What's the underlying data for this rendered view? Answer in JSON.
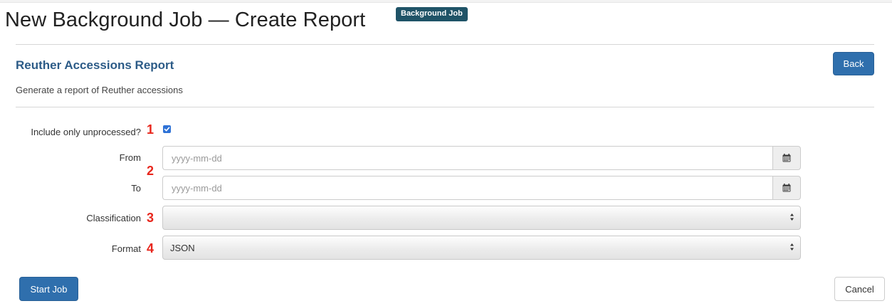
{
  "page": {
    "title": "New Background Job — Create Report",
    "badge": "Background Job"
  },
  "report": {
    "title": "Reuther Accessions Report",
    "description": "Generate a report of Reuther accessions",
    "back_label": "Back"
  },
  "form": {
    "unprocessed": {
      "label": "Include only unprocessed?",
      "checked": true,
      "marker": "1"
    },
    "from": {
      "label": "From",
      "placeholder": "yyyy-mm-dd"
    },
    "to": {
      "label": "To",
      "placeholder": "yyyy-mm-dd"
    },
    "date_marker": "2",
    "classification": {
      "label": "Classification",
      "value": "",
      "marker": "3"
    },
    "format": {
      "label": "Format",
      "value": "JSON",
      "marker": "4"
    }
  },
  "actions": {
    "start_label": "Start Job",
    "cancel_label": "Cancel"
  },
  "icons": {
    "calendar": "calendar-icon",
    "select_arrows": "updown-arrows-icon",
    "checkmark": "check-icon"
  },
  "colors": {
    "primary": "#2f6fad",
    "badge": "#1f5367",
    "report_title": "#2c5b87",
    "marker": "#e8261c",
    "checkbox": "#2f72d6"
  }
}
